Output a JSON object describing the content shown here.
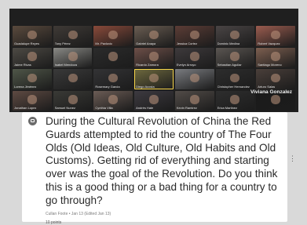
{
  "video_call": {
    "featured_participant": "Viviana Gonzalez",
    "participants": [
      {
        "name": "Guadalupe Reyes",
        "tone": "#5a4a3d"
      },
      {
        "name": "Tony Pérez",
        "tone": "#3f3a36"
      },
      {
        "name": "Mr. Pavlovic",
        "tone": "#8a4a3a"
      },
      {
        "name": "Gabriel Anaya",
        "tone": "#6a5d52"
      },
      {
        "name": "Jessica Cortez",
        "tone": "#5c3d36"
      },
      {
        "name": "Dominic Medina",
        "tone": "#4a4545"
      },
      {
        "name": "Robert Vazquez",
        "tone": "#9b5c4f"
      },
      {
        "name": "Jaime Rivas",
        "tone": "#4d4a44"
      },
      {
        "name": "Isabel Mendoza",
        "tone": "#8a8a86"
      },
      {
        "name": "",
        "tone": "#2b2b2b"
      },
      {
        "name": "Ricardo Zamora",
        "tone": "#6d4f48"
      },
      {
        "name": "Evelyn Arroyo",
        "tone": "#3e3a3c"
      },
      {
        "name": "Sebastian Aguilar",
        "tone": "#5b5652"
      },
      {
        "name": "Santiago Moreno",
        "tone": "#7d5f50"
      },
      {
        "name": "Lorena Jiménez",
        "tone": "#4f5648"
      },
      {
        "name": "",
        "tone": "#3a3a3a"
      },
      {
        "name": "Rosemary Garcia",
        "tone": "#333335"
      },
      {
        "name": "Diego Acosta",
        "tone": "#6f6a3e"
      },
      {
        "name": "",
        "tone": "#7a7c80"
      },
      {
        "name": "Christopher Hernandez",
        "tone": "#2d2d2d"
      },
      {
        "name": "Arturo Salas",
        "tone": "#4a3f3a"
      },
      {
        "name": "Jonathan Lopez",
        "tone": "#5e4a42"
      },
      {
        "name": "Samuel Nunez",
        "tone": "#3a3a36"
      },
      {
        "name": "Cynthia Villa",
        "tone": "#6b5c55"
      },
      {
        "name": "Andrés Hale",
        "tone": "#3d3a40"
      },
      {
        "name": "Kevin Ramirez",
        "tone": "#524c48"
      },
      {
        "name": "Erica Martinez",
        "tone": "#2e2e2e"
      },
      {
        "name": "",
        "tone": "#1a1a1a"
      }
    ]
  },
  "post": {
    "question": "During the Cultural Revolution of China the Red Guards attempted to rid the country of The Four Olds (Old Ideas, Old Culture, Old Habits and Old Customs).  Getting rid of everything and starting over was the goal of the Revolution.   Do you think this is a good thing or a bad thing for a country to go through?",
    "meta": "Cullan Foote • Jan 13 (Edited Jan 13)",
    "points": "10 points",
    "icon": "assignment-icon"
  },
  "colors": {
    "highlight": "#f7d54a",
    "panel_bg": "#1f1f1f",
    "page_bg": "#d9d9d9"
  }
}
